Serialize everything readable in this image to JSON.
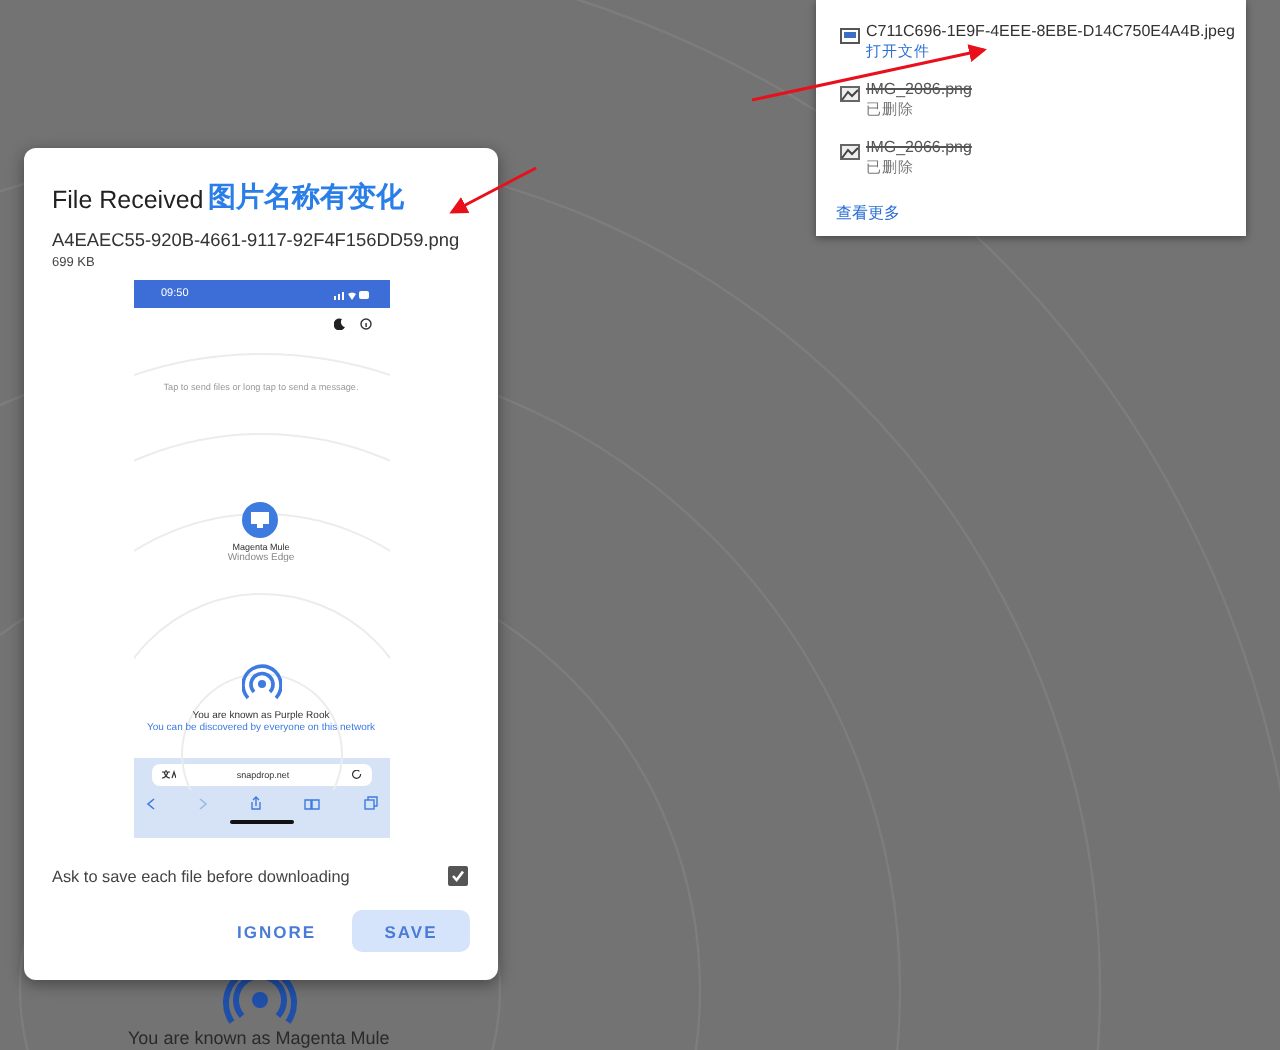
{
  "background": {
    "device_label": "You are known as Magenta Mule"
  },
  "downloads_popup": {
    "items": [
      {
        "name": "C711C696-1E9F-4EEE-8EBE-D14C750E4A4B.jpeg",
        "status": "打开文件",
        "kind": "available"
      },
      {
        "name": "IMG_2086.png",
        "status": "已删除",
        "kind": "deleted"
      },
      {
        "name": "IMG_2066.png",
        "status": "已删除",
        "kind": "deleted"
      }
    ],
    "more_link": "查看更多"
  },
  "dialog": {
    "title": "File Received",
    "file_name": "A4EAEC55-920B-4661-9117-92F4F156DD59.png",
    "file_size": "699 KB",
    "preview": {
      "time": "09:50",
      "hint": "Tap to send files or long tap to send a message.",
      "peer": {
        "name": "Magenta Mule",
        "device": "Windows Edge"
      },
      "self": {
        "title": "You are known as Purple Rook",
        "note": "You can be discovered by everyone on this network"
      },
      "url": "snapdrop.net"
    },
    "ask_checkbox": {
      "label": "Ask to save each file before downloading",
      "checked": true
    },
    "buttons": [
      {
        "label": "IGNORE",
        "kind": "text"
      },
      {
        "label": "SAVE",
        "kind": "filled"
      }
    ]
  },
  "annotation": {
    "text": "图片名称有变化"
  }
}
